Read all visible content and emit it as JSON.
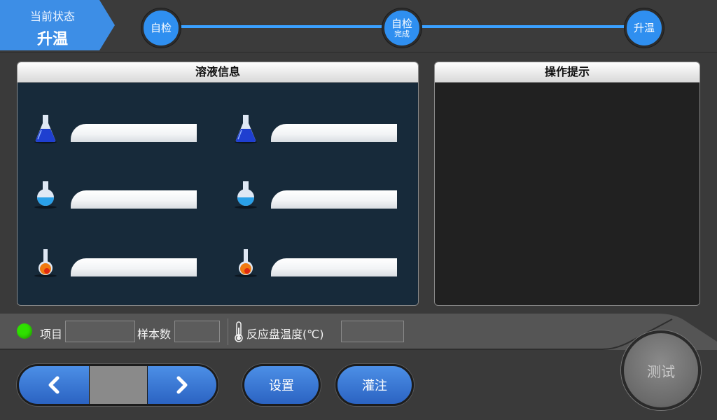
{
  "status": {
    "label": "当前状态",
    "value": "升温"
  },
  "steps": [
    {
      "line1": "自检",
      "line2": ""
    },
    {
      "line1": "自检",
      "line2": "完成"
    },
    {
      "line1": "升温",
      "line2": ""
    }
  ],
  "solution_panel": {
    "title": "溶液信息"
  },
  "hint_panel": {
    "title": "操作提示",
    "text": ""
  },
  "flask_icons": [
    "blue-flask-icon",
    "blue-round-flask-icon",
    "orange-flask-icon"
  ],
  "info_bar": {
    "project_label": "项目",
    "project_value": "",
    "sample_count_label": "样本数",
    "sample_count_value": "",
    "temperature_label": "反应盘温度(℃)",
    "temperature_value": ""
  },
  "buttons": {
    "settings": "设置",
    "fill": "灌注",
    "test": "测试",
    "page_value": ""
  },
  "colors": {
    "accent": "#2f8ff0",
    "status_led": "#2fe000",
    "panel_body": "#172a3a"
  }
}
